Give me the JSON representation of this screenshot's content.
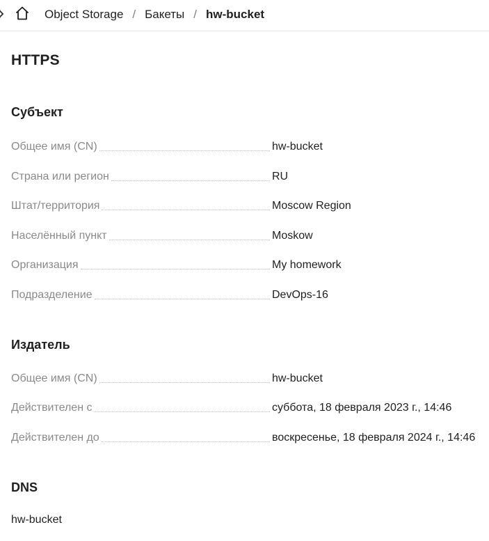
{
  "breadcrumb": {
    "items": [
      "Object Storage",
      "Бакеты",
      "hw-bucket"
    ],
    "separator": "/"
  },
  "icons": {
    "home": "home-icon",
    "partial": "settings-icon"
  },
  "title": "HTTPS",
  "subject": {
    "title": "Субъект",
    "rows": [
      {
        "label": "Общее имя (CN)",
        "value": "hw-bucket"
      },
      {
        "label": "Страна или регион",
        "value": "RU"
      },
      {
        "label": "Штат/территория",
        "value": "Moscow Region"
      },
      {
        "label": "Населённый пункт",
        "value": "Moskow"
      },
      {
        "label": "Организация",
        "value": "My homework"
      },
      {
        "label": "Подразделение",
        "value": "DevOps-16"
      }
    ]
  },
  "issuer": {
    "title": "Издатель",
    "rows": [
      {
        "label": "Общее имя (CN)",
        "value": "hw-bucket"
      },
      {
        "label": "Действителен с",
        "value": "суббота, 18 февраля 2023 г., 14:46"
      },
      {
        "label": "Действителен до",
        "value": "воскресенье, 18 февраля 2024 г., 14:46"
      }
    ]
  },
  "dns": {
    "title": "DNS",
    "value": "hw-bucket"
  }
}
